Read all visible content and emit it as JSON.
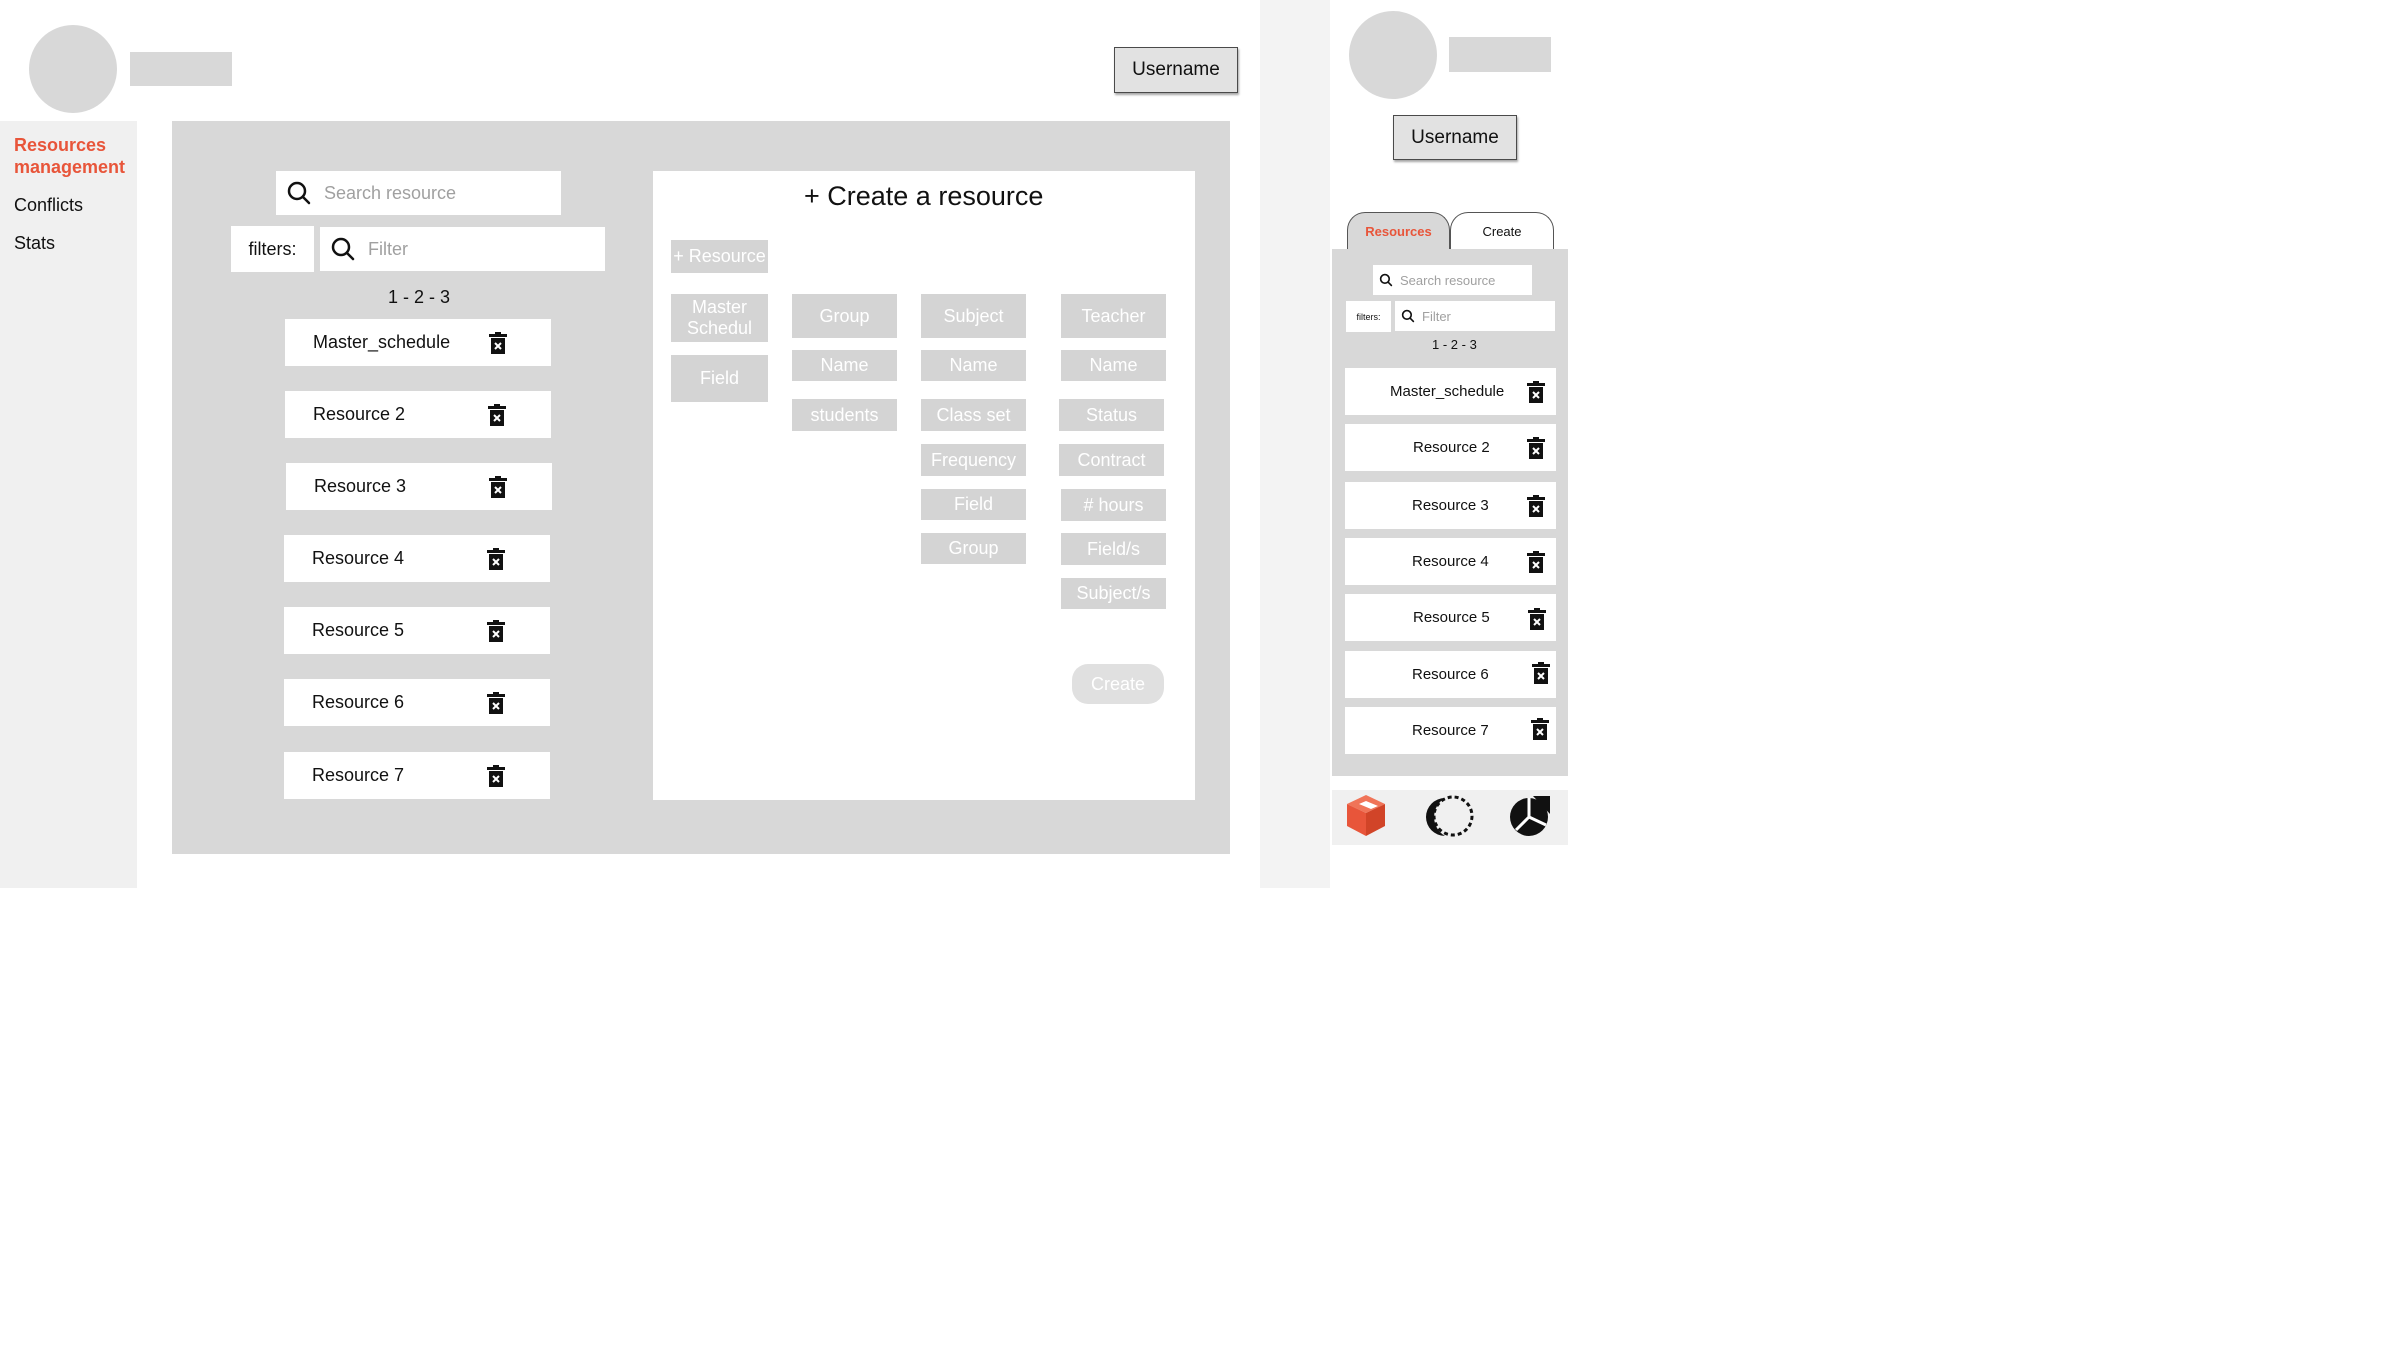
{
  "header": {
    "username": "Username"
  },
  "sidebar": {
    "items": [
      {
        "label_line1": "Resources",
        "label_line2": "management",
        "active": true
      },
      {
        "label": "Conflicts"
      },
      {
        "label": "Stats"
      }
    ]
  },
  "resources_panel": {
    "search_placeholder": "Search resource",
    "filters_label": "filters:",
    "filter_placeholder": "Filter",
    "pagination": "1 - 2 - 3",
    "items": [
      "Master_schedule",
      "Resource 2",
      "Resource 3",
      "Resource 4",
      "Resource 5",
      "Resource 6",
      "Resource 7"
    ]
  },
  "create_panel": {
    "title": "+ Create a resource",
    "add_resource": "+ Resource",
    "types": {
      "master_line1": "Master",
      "master_line2": "Schedul",
      "field": "Field"
    },
    "group_col": [
      "Group",
      "Name",
      "students"
    ],
    "subject_col": [
      "Subject",
      "Name",
      "Class set",
      "Frequency",
      "Field",
      "Group"
    ],
    "teacher_col": [
      "Teacher",
      "Name",
      "Status",
      "Contract",
      "# hours",
      "Field/s",
      "Subject/s"
    ],
    "create_button": "Create"
  },
  "mobile": {
    "username": "Username",
    "tabs": [
      "Resources",
      "Create"
    ],
    "search_placeholder": "Search resource",
    "filters_label": "filters:",
    "filter_placeholder": "Filter",
    "pagination": "1 - 2 - 3",
    "items": [
      "Master_schedule",
      "Resource 2",
      "Resource 3",
      "Resource 4",
      "Resource 5",
      "Resource 6",
      "Resource 7"
    ],
    "bottom_nav_icons": [
      "cube-icon",
      "moon-icon",
      "pie-chart-icon"
    ]
  },
  "colors": {
    "accent": "#e8553a",
    "panel": "#d8d8d8",
    "chip": "#d4d4d4"
  }
}
